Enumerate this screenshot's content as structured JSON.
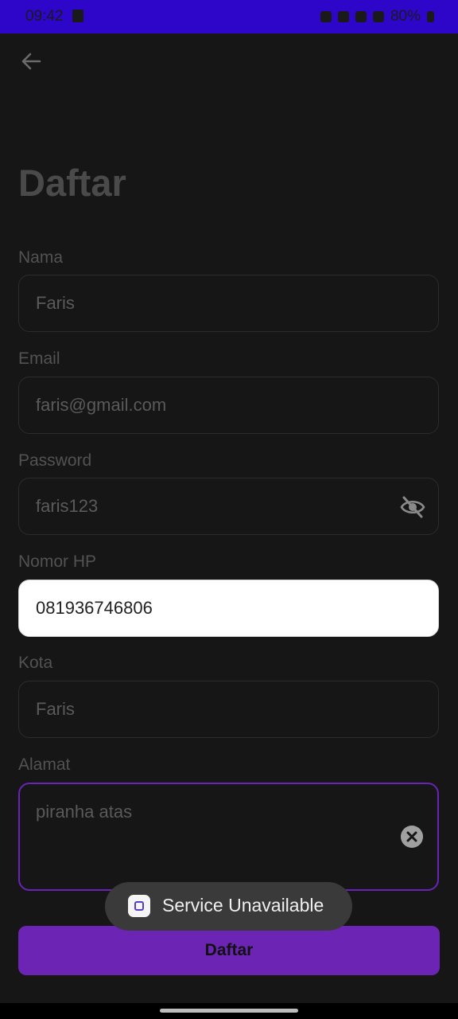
{
  "status_bar": {
    "time": "09:42",
    "battery": "80%"
  },
  "colors": {
    "status_bar": "#2d06c9",
    "accent": "#6c24b4",
    "background": "#161616"
  },
  "page": {
    "title": "Daftar"
  },
  "fields": {
    "nama": {
      "label": "Nama",
      "value": "Faris"
    },
    "email": {
      "label": "Email",
      "value": "faris@gmail.com"
    },
    "password": {
      "label": "Password",
      "value": "faris123"
    },
    "nomor_hp": {
      "label": "Nomor HP",
      "value": "081936746806"
    },
    "kota": {
      "label": "Kota",
      "value": "Faris"
    },
    "alamat": {
      "label": "Alamat",
      "value": "piranha atas"
    }
  },
  "submit": {
    "label": "Daftar"
  },
  "toast": {
    "text": "Service Unavailable"
  },
  "icons": {
    "back": "arrow-left-icon",
    "password_toggle": "eye-off-icon",
    "clear": "close-circle-icon"
  }
}
